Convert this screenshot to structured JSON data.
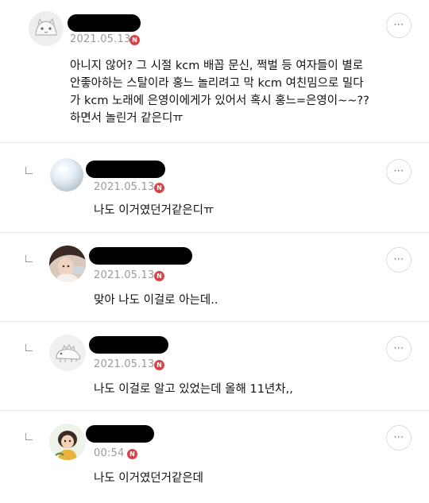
{
  "comments": [
    {
      "avatar": "cat-avatar-icon",
      "date": "2021.05.13",
      "badge": "N",
      "text": "아니지 않어? 그 시절 kcm 배꼽 문신, 쩍벌 등 여자들이 별로\n안좋아하는 스탈이라 홍느 놀리려고 막 kcm 여친밈으로 밀다\n가 kcm 노래에 은영이에게가 있어서 혹시 홍느=은영이~~??\n하면서 놀린거 같은디ㅠ"
    },
    {
      "avatar": "glass-orb-avatar",
      "date": "2021.05.13",
      "badge": "N",
      "text": "나도 이거였던거같은디ㅠ"
    },
    {
      "avatar": "photo-avatar",
      "date": "2021.05.13",
      "badge": "N",
      "text": "맞아 나도 이걸로 아는데.."
    },
    {
      "avatar": "dinosaur-avatar-icon",
      "date": "2021.05.13",
      "badge": "N",
      "text": "나도 이걸로 알고 있었는데 올해 11년차,,"
    },
    {
      "avatar": "cartoon-girl-avatar",
      "date": "00:54",
      "badge": "N",
      "text": "나도 이거였던거같은데"
    }
  ],
  "more_label": "···",
  "colors": {
    "badge": "#d8434a",
    "date": "#9a9a9a",
    "divider": "#e6e6e6"
  }
}
